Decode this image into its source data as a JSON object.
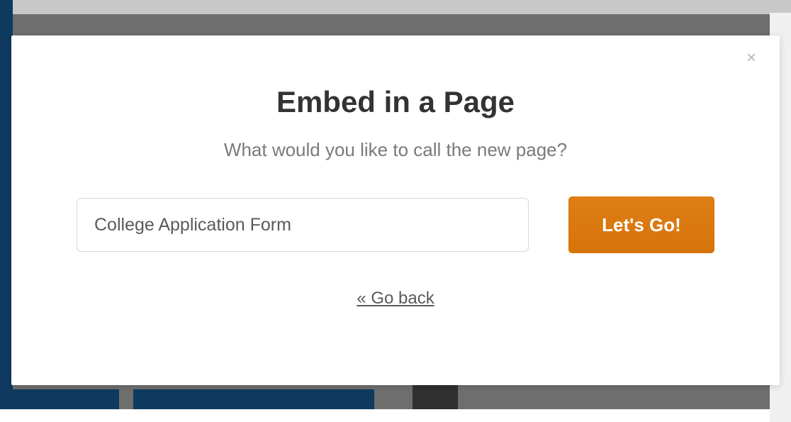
{
  "modal": {
    "title": "Embed in a Page",
    "subtitle": "What would you like to call the new page?",
    "input": {
      "value": "College Application Form"
    },
    "submit_label": "Let's Go!",
    "back_label": "« Go back",
    "close_icon": "×"
  }
}
